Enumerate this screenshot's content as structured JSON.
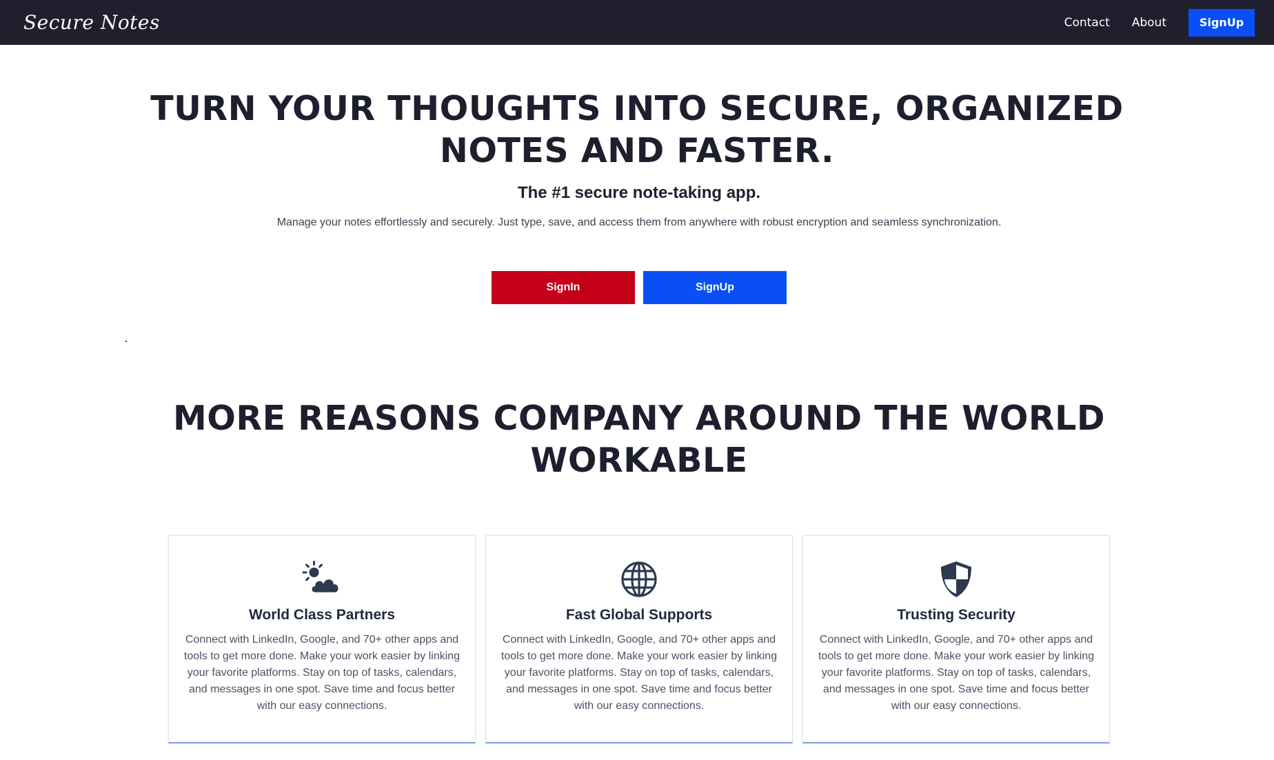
{
  "navbar": {
    "brand": "Secure Notes",
    "links": [
      "Contact",
      "About"
    ],
    "signup_label": "SignUp"
  },
  "hero": {
    "title": "TURN YOUR THOUGHTS INTO SECURE, ORGANIZED NOTES AND FASTER.",
    "subtitle": "The #1 secure note-taking app.",
    "description": "Manage your notes effortlessly and securely. Just type, save, and access them from anywhere with robust encryption and seamless synchronization.",
    "signin_label": "SignIn",
    "signup_label": "SignUp"
  },
  "reasons": {
    "title": "MORE REASONS COMPANY AROUND THE WORLD WORKABLE",
    "cards": [
      {
        "icon": "cloud-sun-icon",
        "title": "World Class Partners",
        "text": "Connect with LinkedIn, Google, and 70+ other apps and tools to get more done. Make your work easier by linking your favorite platforms. Stay on top of tasks, calendars, and messages in one spot. Save time and focus better with our easy connections."
      },
      {
        "icon": "globe-icon",
        "title": "Fast Global Supports",
        "text": "Connect with LinkedIn, Google, and 70+ other apps and tools to get more done. Make your work easier by linking your favorite platforms. Stay on top of tasks, calendars, and messages in one spot. Save time and focus better with our easy connections."
      },
      {
        "icon": "shield-icon",
        "title": "Trusting Security",
        "text": "Connect with LinkedIn, Google, and 70+ other apps and tools to get more done. Make your work easier by linking your favorite platforms. Stay on top of tasks, calendars, and messages in one spot. Save time and focus better with our easy connections."
      }
    ]
  },
  "colors": {
    "navbar_bg": "#1f1f2e",
    "primary_blue": "#0a4ff5",
    "signin_red": "#c40018",
    "heading_text": "#1e1f2e",
    "icon_color": "#2c3a50"
  }
}
